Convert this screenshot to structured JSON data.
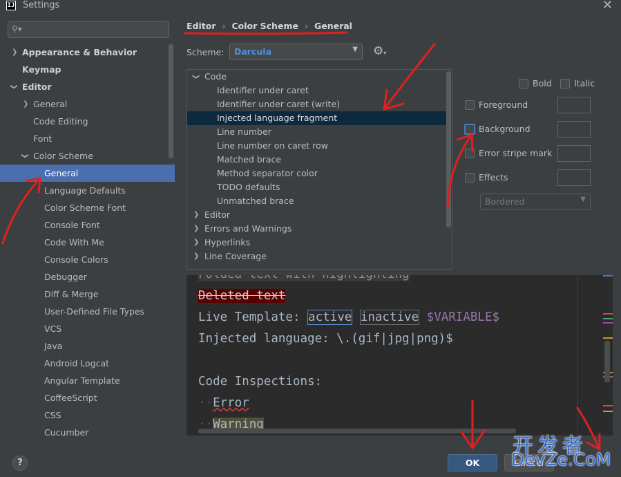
{
  "window": {
    "title": "Settings",
    "app_icon_text": "IJ"
  },
  "search": {
    "value": "",
    "placeholder": ""
  },
  "sidebar": {
    "items": [
      {
        "label": "Appearance & Behavior"
      },
      {
        "label": "Keymap"
      },
      {
        "label": "Editor"
      },
      {
        "label": "General"
      },
      {
        "label": "Code Editing"
      },
      {
        "label": "Font"
      },
      {
        "label": "Color Scheme"
      },
      {
        "label": "General"
      },
      {
        "label": "Language Defaults"
      },
      {
        "label": "Color Scheme Font"
      },
      {
        "label": "Console Font"
      },
      {
        "label": "Code With Me"
      },
      {
        "label": "Console Colors"
      },
      {
        "label": "Debugger"
      },
      {
        "label": "Diff & Merge"
      },
      {
        "label": "User-Defined File Types"
      },
      {
        "label": "VCS"
      },
      {
        "label": "Java"
      },
      {
        "label": "Android Logcat"
      },
      {
        "label": "Angular Template"
      },
      {
        "label": "CoffeeScript"
      },
      {
        "label": "CSS"
      },
      {
        "label": "Cucumber"
      }
    ]
  },
  "breadcrumb": {
    "a": "Editor",
    "b": "Color Scheme",
    "c": "General",
    "sep": "›"
  },
  "scheme": {
    "label": "Scheme:",
    "value": "Darcula"
  },
  "attributes": {
    "items": [
      {
        "label": "Code"
      },
      {
        "label": "Identifier under caret"
      },
      {
        "label": "Identifier under caret (write)"
      },
      {
        "label": "Injected language fragment"
      },
      {
        "label": "Line number"
      },
      {
        "label": "Line number on caret row"
      },
      {
        "label": "Matched brace"
      },
      {
        "label": "Method separator color"
      },
      {
        "label": "TODO defaults"
      },
      {
        "label": "Unmatched brace"
      },
      {
        "label": "Editor"
      },
      {
        "label": "Errors and Warnings"
      },
      {
        "label": "Hyperlinks"
      },
      {
        "label": "Line Coverage"
      }
    ]
  },
  "options": {
    "bold": "Bold",
    "italic": "Italic",
    "foreground": "Foreground",
    "background": "Background",
    "error_stripe": "Error stripe mark",
    "effects": "Effects",
    "effects_type": "Bordered"
  },
  "preview": {
    "folded": "Folded text with highlighting",
    "deleted": "Deleted text",
    "live_template_prefix": "Live Template: ",
    "active": "active",
    "inactive": "inactive",
    "variable": "$VARIABLE$",
    "injected": "Injected language: \\.(gif|jpg|png)$",
    "inspections": "Code Inspections:",
    "error": "Error",
    "warning": "Warning"
  },
  "buttons": {
    "ok": "OK",
    "cancel": "Cancel",
    "help": "?"
  },
  "watermark": {
    "cn": "开发者",
    "en": "DevZe.CoM"
  },
  "colors": {
    "accent": "#4b6eaf",
    "selected_attr": "#0d293e",
    "annotation": "#e02020",
    "variable": "#9876aa"
  }
}
